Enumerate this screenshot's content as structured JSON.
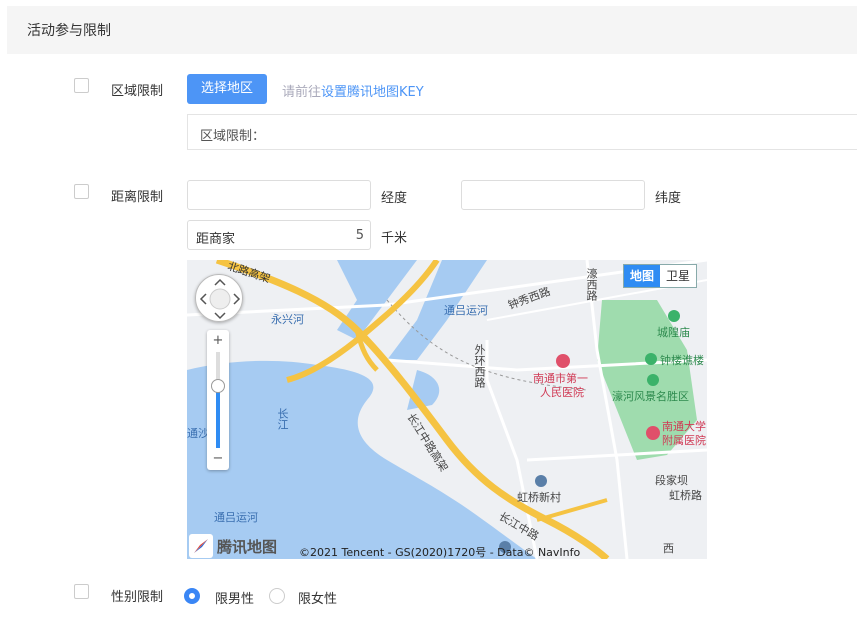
{
  "section": {
    "title": "活动参与限制"
  },
  "region": {
    "label": "区域限制",
    "select_button": "选择地区",
    "hint_prefix": "请前往",
    "hint_link": "设置腾讯地图KEY",
    "field_label": "区域限制："
  },
  "distance": {
    "label": "距离限制",
    "longitude_value": "",
    "longitude_unit": "经度",
    "latitude_value": "",
    "latitude_unit": "纬度",
    "from_merchant_label": "距商家",
    "from_merchant_value": "5",
    "distance_unit": "千米"
  },
  "map": {
    "type_buttons": [
      "地图",
      "卫星"
    ],
    "active_type": "地图",
    "logo_text": "腾讯地图",
    "copyright": "©2021 Tencent - GS(2020)1720号 - Data© NavInfo",
    "labels": [
      {
        "text": "北路高架"
      },
      {
        "text": "永兴河"
      },
      {
        "text": "通吕运河"
      },
      {
        "text": "钟秀西路"
      },
      {
        "text": "濠西路"
      },
      {
        "text": "城隍庙"
      },
      {
        "text": "钟楼谯楼"
      },
      {
        "text": "外环西路"
      },
      {
        "text": "南通市第一"
      },
      {
        "text": "人民医院"
      },
      {
        "text": "濠河风景名胜区"
      },
      {
        "text": "长江"
      },
      {
        "text": "通沙"
      },
      {
        "text": "长江中路高架"
      },
      {
        "text": "南通大学"
      },
      {
        "text": "附属医院"
      },
      {
        "text": "段家坝"
      },
      {
        "text": "虹桥路"
      },
      {
        "text": "虹桥新村"
      },
      {
        "text": "长江中路"
      },
      {
        "text": "通吕运河"
      },
      {
        "text": "西"
      }
    ]
  },
  "gender": {
    "label": "性别限制",
    "options": [
      "限男性",
      "限女性"
    ],
    "selected": "限男性"
  },
  "colors": {
    "primary": "#4d95f6",
    "map_water": "#a6cbf2",
    "map_road": "#f5c342"
  }
}
